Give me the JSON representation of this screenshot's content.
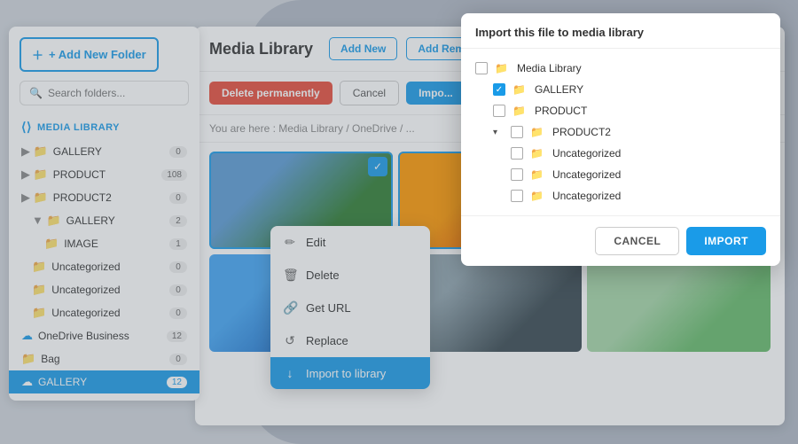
{
  "sidebar": {
    "add_folder_label": "+ Add New Folder",
    "search_placeholder": "Search folders...",
    "media_library_label": "MEDIA LIBRARY",
    "items": [
      {
        "label": "GALLERY",
        "badge": "0",
        "indent": 0,
        "active": false
      },
      {
        "label": "PRODUCT",
        "badge": "108",
        "indent": 0,
        "active": false
      },
      {
        "label": "PRODUCT2",
        "badge": "0",
        "indent": 0,
        "active": false
      },
      {
        "label": "GALLERY",
        "badge": "2",
        "indent": 1,
        "active": false
      },
      {
        "label": "IMAGE",
        "badge": "1",
        "indent": 2,
        "active": false
      },
      {
        "label": "Uncategorized",
        "badge": "0",
        "indent": 1,
        "active": false
      },
      {
        "label": "Uncategorized",
        "badge": "0",
        "indent": 1,
        "active": false
      },
      {
        "label": "Uncategorized",
        "badge": "0",
        "indent": 1,
        "active": false
      },
      {
        "label": "OneDrive Business",
        "badge": "12",
        "indent": 0,
        "cloud": true,
        "active": false
      },
      {
        "label": "Bag",
        "badge": "0",
        "indent": 0,
        "cloud": false,
        "active": false
      },
      {
        "label": "GALLERY",
        "badge": "12",
        "indent": 0,
        "cloud": true,
        "active": true
      }
    ]
  },
  "main": {
    "title": "Media Library",
    "btn_add_new": "Add New",
    "btn_add_remote": "Add Remot...",
    "toolbar": {
      "delete_label": "Delete permanently",
      "cancel_label": "Cancel",
      "import_label": "Impo..."
    },
    "breadcrumb": "You are here :  Media Library / OneDrive / ..."
  },
  "context_menu": {
    "items": [
      {
        "label": "Edit",
        "icon": "✏️"
      },
      {
        "label": "Delete",
        "icon": "🗑️"
      },
      {
        "label": "Get URL",
        "icon": "🔗"
      },
      {
        "label": "Replace",
        "icon": "↺"
      },
      {
        "label": "Import to library",
        "icon": "↓",
        "highlighted": true
      }
    ]
  },
  "import_dialog": {
    "title": "Import this file to media library",
    "tree": [
      {
        "label": "Media Library",
        "checked": false,
        "indent": 0,
        "toggle": ""
      },
      {
        "label": "GALLERY",
        "checked": true,
        "indent": 1,
        "toggle": ""
      },
      {
        "label": "PRODUCT",
        "checked": false,
        "indent": 1,
        "toggle": ""
      },
      {
        "label": "PRODUCT2",
        "checked": false,
        "indent": 1,
        "toggle": "▾"
      },
      {
        "label": "Uncategorized",
        "checked": false,
        "indent": 2,
        "toggle": ""
      },
      {
        "label": "Uncategorized",
        "checked": false,
        "indent": 2,
        "toggle": ""
      },
      {
        "label": "Uncategorized",
        "checked": false,
        "indent": 2,
        "toggle": ""
      }
    ],
    "cancel_label": "CANCEL",
    "import_label": "IMPORT"
  }
}
